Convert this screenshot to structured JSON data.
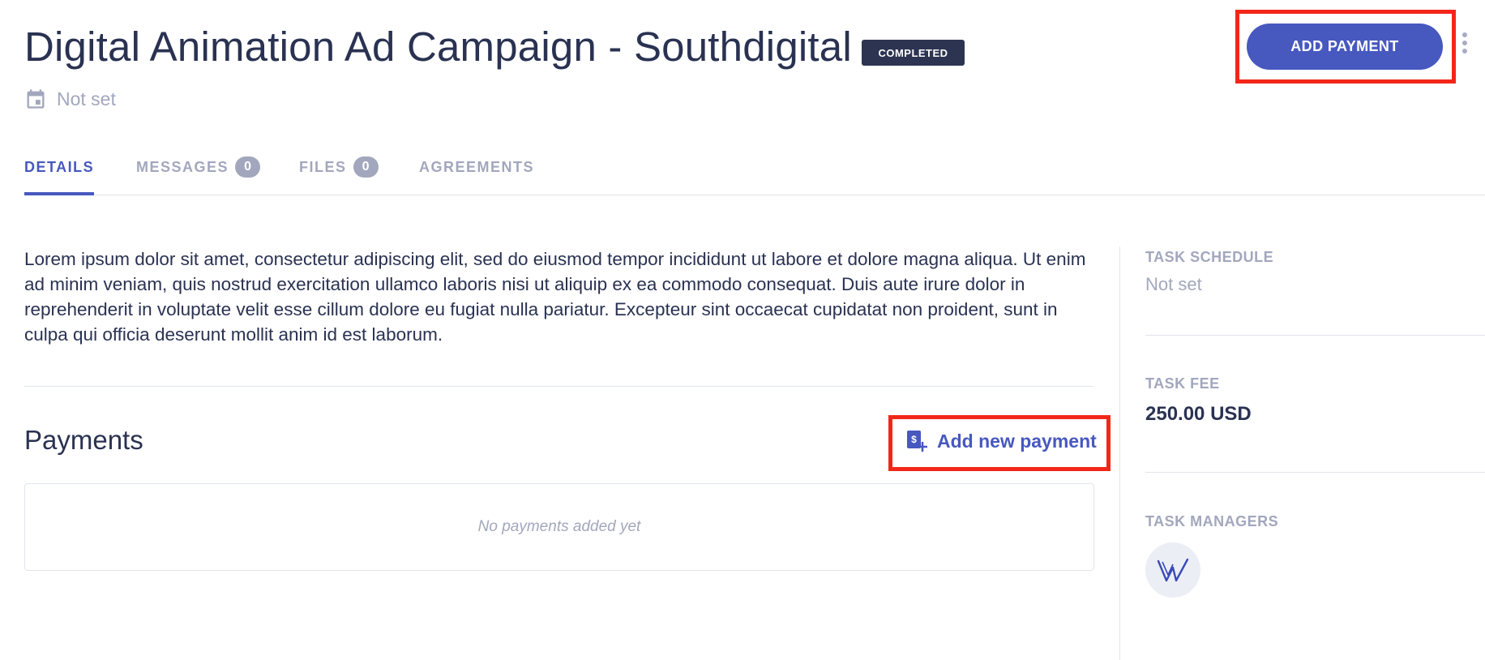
{
  "header": {
    "title": "Digital Animation Ad Campaign - Southdigital",
    "status": "COMPLETED",
    "date": "Not set",
    "primary_action": "ADD PAYMENT"
  },
  "tabs": [
    {
      "label": "DETAILS",
      "active": true
    },
    {
      "label": "MESSAGES",
      "count": "0"
    },
    {
      "label": "FILES",
      "count": "0"
    },
    {
      "label": "AGREEMENTS"
    }
  ],
  "details": {
    "description": "Lorem ipsum dolor sit amet, consectetur adipiscing elit, sed do eiusmod tempor incididunt ut labore et dolore magna aliqua. Ut enim ad minim veniam, quis nostrud exercitation ullamco laboris nisi ut aliquip ex ea commodo consequat. Duis aute irure dolor in reprehenderit in voluptate velit esse cillum dolore eu fugiat nulla pariatur. Excepteur sint occaecat cupidatat non proident, sunt in culpa qui officia deserunt mollit anim id est laborum."
  },
  "payments": {
    "heading": "Payments",
    "add_link": "Add new payment",
    "empty": "No payments added yet"
  },
  "sidebar": {
    "schedule_label": "TASK SCHEDULE",
    "schedule_value": "Not set",
    "fee_label": "TASK FEE",
    "fee_value": "250.00 USD",
    "managers_label": "TASK MANAGERS"
  },
  "colors": {
    "accent": "#4758bf",
    "badge_bg": "#2d3452",
    "muted": "#a2a7bd",
    "highlight": "#f2271a"
  },
  "icons": [
    "calendar-icon",
    "more-vertical-icon",
    "add-payment-icon",
    "manager-logo"
  ]
}
